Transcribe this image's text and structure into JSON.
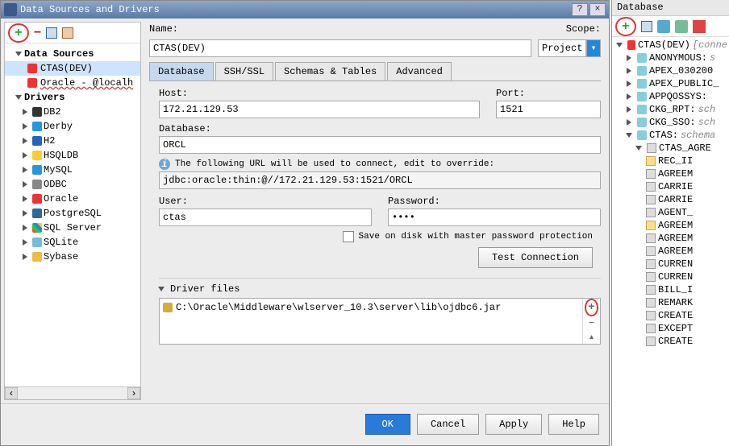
{
  "dialog": {
    "title": "Data Sources and Drivers",
    "name_label": "Name:",
    "name_value": "CTAS(DEV)",
    "scope_label": "Scope:",
    "scope_value": "Project"
  },
  "left": {
    "ds_header": "Data Sources",
    "ds_items": [
      {
        "label": "CTAS(DEV)",
        "icon": "oracle",
        "selected": true
      },
      {
        "label": "Oracle - @localh",
        "icon": "oracle",
        "error": true
      }
    ],
    "drv_header": "Drivers",
    "drv_items": [
      {
        "label": "DB2",
        "icon": "ibm"
      },
      {
        "label": "Derby",
        "icon": "blue"
      },
      {
        "label": "H2",
        "icon": "h2"
      },
      {
        "label": "HSQLDB",
        "icon": "yel"
      },
      {
        "label": "MySQL",
        "icon": "blue"
      },
      {
        "label": "ODBC",
        "icon": "odbc"
      },
      {
        "label": "Oracle",
        "icon": "oracle"
      },
      {
        "label": "PostgreSQL",
        "icon": "pg"
      },
      {
        "label": "SQL Server",
        "icon": "ms"
      },
      {
        "label": "SQLite",
        "icon": "lite"
      },
      {
        "label": "Sybase",
        "icon": "syb"
      }
    ]
  },
  "tabs": [
    "Database",
    "SSH/SSL",
    "Schemas & Tables",
    "Advanced"
  ],
  "form": {
    "host_label": "Host:",
    "host_value": "172.21.129.53",
    "port_label": "Port:",
    "port_value": "1521",
    "db_label": "Database:",
    "db_value": "ORCL",
    "info": "The following URL will be used to connect, edit to override:",
    "url_value": "jdbc:oracle:thin:@//172.21.129.53:1521/ORCL",
    "user_label": "User:",
    "user_value": "ctas",
    "pass_label": "Password:",
    "pass_value": "••••",
    "save_chk": "Save on disk with master password protection",
    "test_btn": "Test Connection",
    "driver_hdr": "Driver files",
    "driver_path": "C:\\Oracle\\Middleware\\wlserver_10.3\\server\\lib\\ojdbc6.jar"
  },
  "footer": {
    "ok": "OK",
    "cancel": "Cancel",
    "apply": "Apply",
    "help": "Help"
  },
  "side": {
    "title": "Database",
    "root": "CTAS(DEV)",
    "root_suffix": "[conne",
    "schemas": [
      {
        "label": "ANONYMOUS:",
        "suffix": "s"
      },
      {
        "label": "APEX_030200"
      },
      {
        "label": "APEX_PUBLIC_"
      },
      {
        "label": "APPQOSSYS:"
      },
      {
        "label": "CKG_RPT:",
        "suffix": "sch"
      },
      {
        "label": "CKG_SSO:",
        "suffix": "sch"
      }
    ],
    "active_schema": "CTAS:",
    "active_suffix": "schema",
    "table": "CTAS_AGRE",
    "columns": [
      {
        "label": "REC_II",
        "icon": "col-ico"
      },
      {
        "label": "AGREEM",
        "icon": "tbl-ico"
      },
      {
        "label": "CARRIE",
        "icon": "tbl-ico"
      },
      {
        "label": "CARRIE",
        "icon": "tbl-ico"
      },
      {
        "label": "AGENT_",
        "icon": "tbl-ico"
      },
      {
        "label": "AGREEM",
        "icon": "col-ico"
      },
      {
        "label": "AGREEM",
        "icon": "tbl-ico"
      },
      {
        "label": "AGREEM",
        "icon": "tbl-ico"
      },
      {
        "label": "CURREN",
        "icon": "tbl-ico"
      },
      {
        "label": "CURREN",
        "icon": "tbl-ico"
      },
      {
        "label": "BILL_I",
        "icon": "tbl-ico"
      },
      {
        "label": "REMARK",
        "icon": "tbl-ico"
      },
      {
        "label": "CREATE",
        "icon": "tbl-ico"
      },
      {
        "label": "EXCEPT",
        "icon": "tbl-ico"
      },
      {
        "label": "CREATE",
        "icon": "tbl-ico"
      }
    ]
  }
}
